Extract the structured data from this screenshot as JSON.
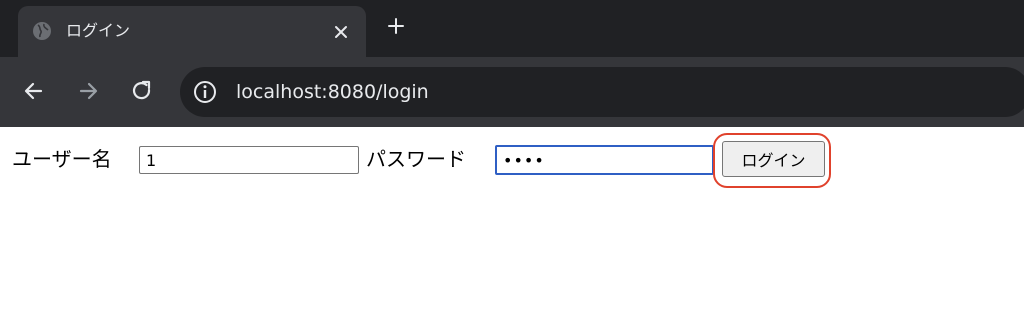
{
  "browser": {
    "tab": {
      "title": "ログイン",
      "favicon": "globe-icon",
      "close_icon": "close-icon"
    },
    "new_tab_icon": "plus-icon",
    "toolbar": {
      "back_icon": "arrow-left-icon",
      "forward_icon": "arrow-right-icon",
      "reload_icon": "reload-icon",
      "site_info_icon": "info-icon",
      "url": "localhost:8080/login"
    }
  },
  "login_form": {
    "username_label": "ユーザー名",
    "username_value": "1",
    "password_label": "パスワード",
    "password_value": "••••",
    "submit_label": "ログイン",
    "highlight_color": "#e0422c",
    "focus_color": "#2f5fc4"
  }
}
